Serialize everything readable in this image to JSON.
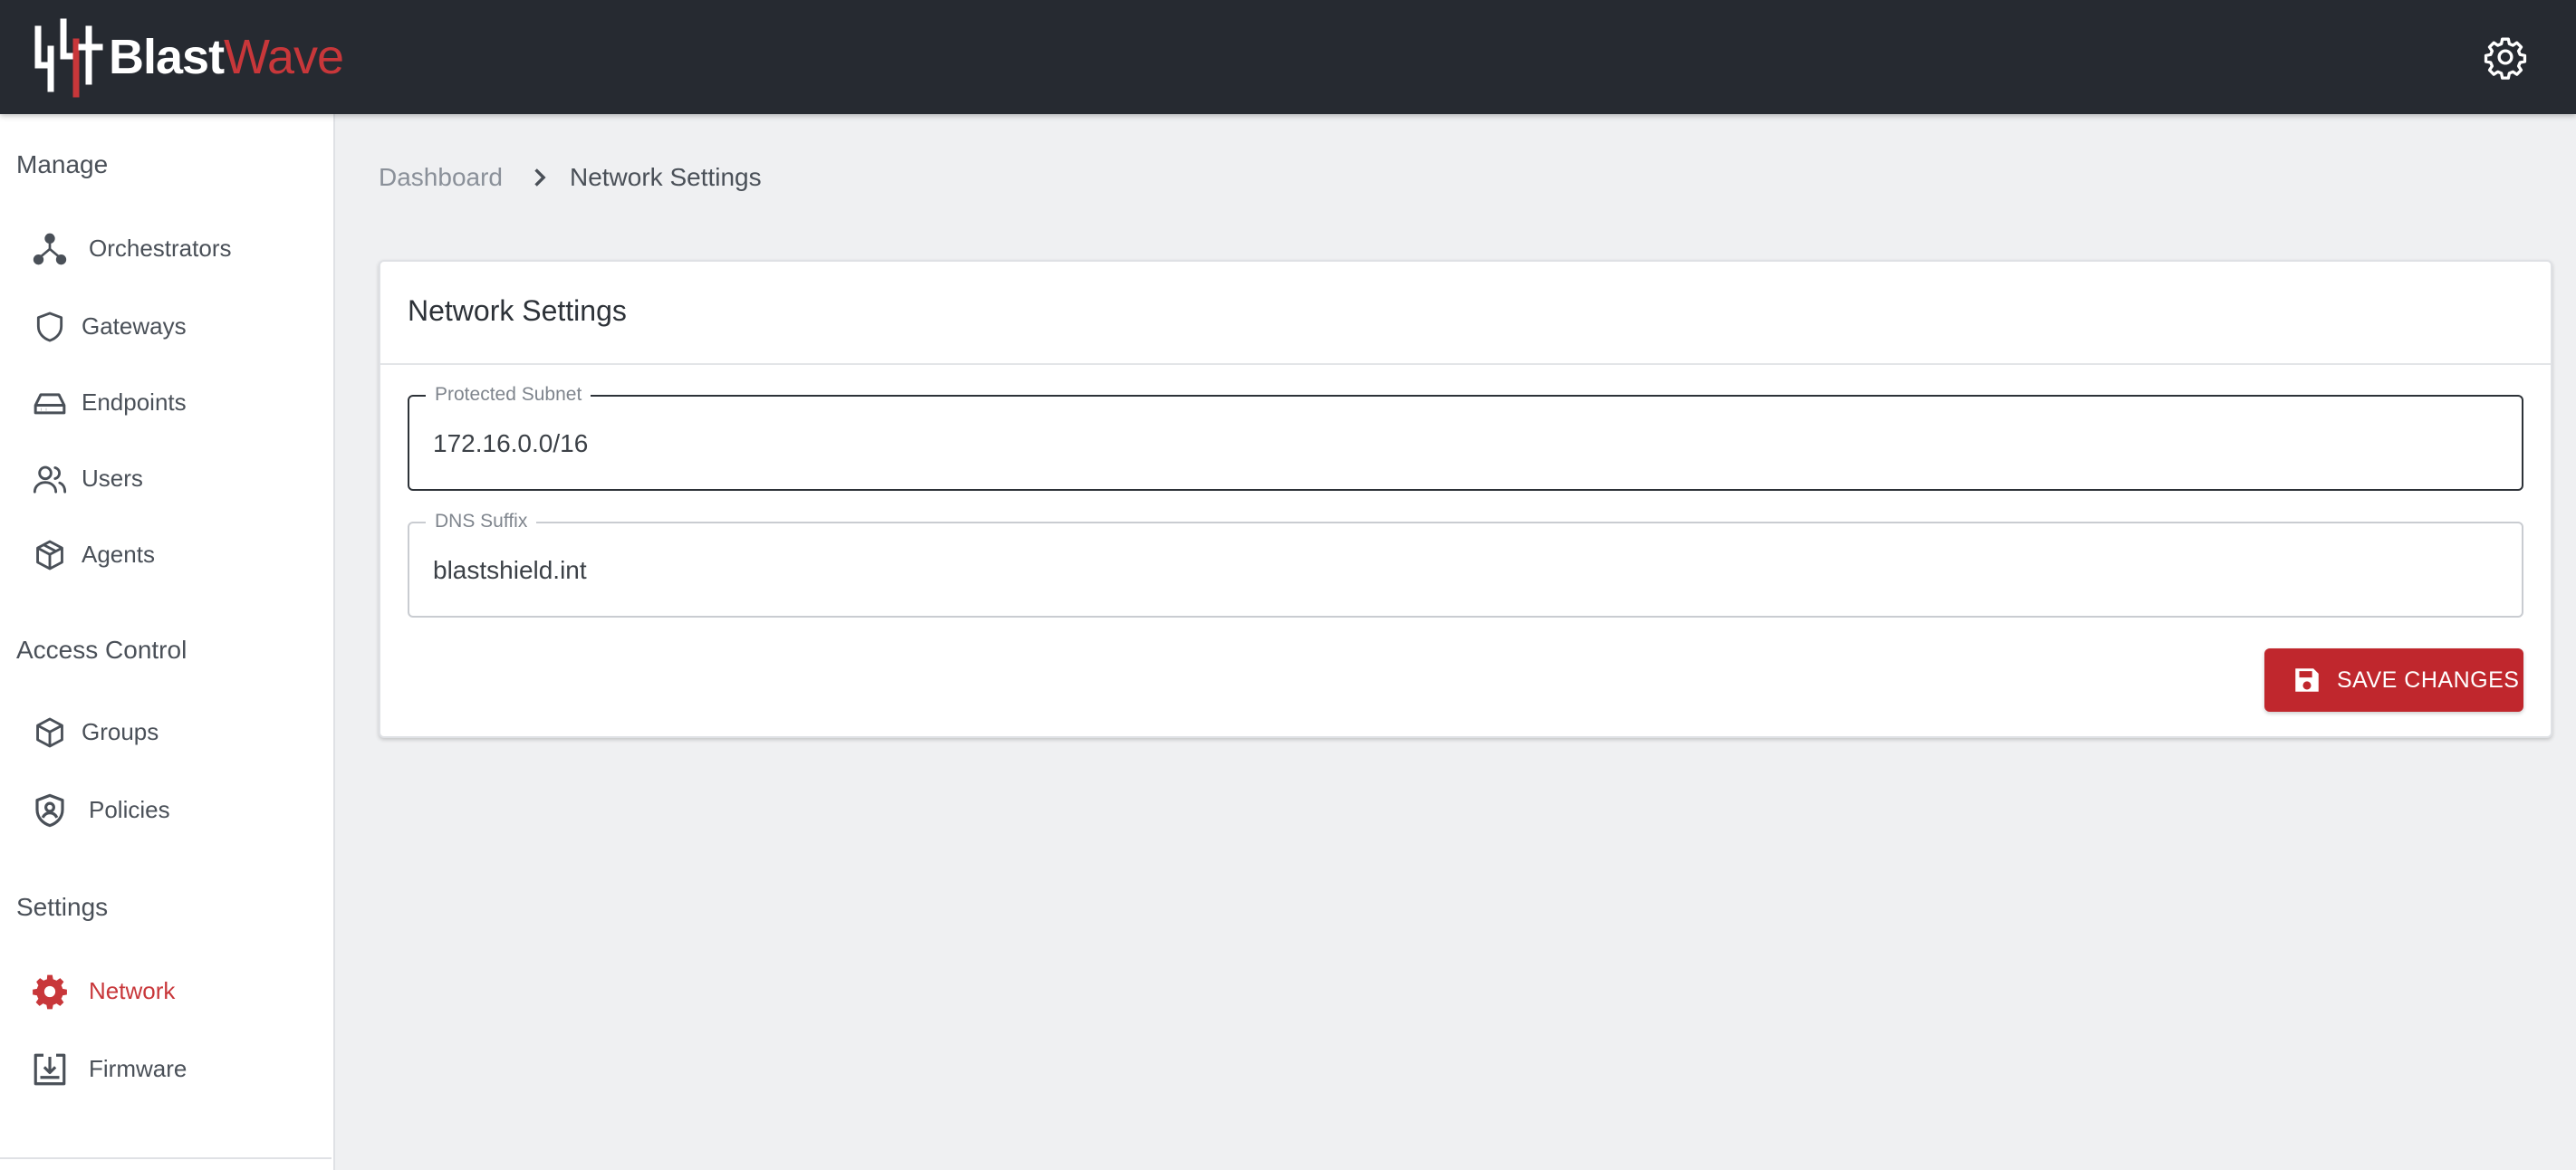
{
  "brand": {
    "name_part1": "Blast",
    "name_part2": "Wave",
    "primary": "#c8373a",
    "topbar_bg": "#262a31"
  },
  "header": {
    "settings_icon": "gear-icon"
  },
  "sidebar": {
    "sections": [
      {
        "title": "Manage",
        "items": [
          {
            "label": "Orchestrators",
            "icon": "network-hub-icon"
          },
          {
            "label": "Gateways",
            "icon": "shield-icon"
          },
          {
            "label": "Endpoints",
            "icon": "hard-drive-icon"
          },
          {
            "label": "Users",
            "icon": "users-icon"
          },
          {
            "label": "Agents",
            "icon": "cube-icon"
          }
        ]
      },
      {
        "title": "Access Control",
        "items": [
          {
            "label": "Groups",
            "icon": "cube-icon"
          },
          {
            "label": "Policies",
            "icon": "shield-user-icon"
          }
        ]
      },
      {
        "title": "Settings",
        "items": [
          {
            "label": "Network",
            "icon": "gear-icon",
            "active": true
          },
          {
            "label": "Firmware",
            "icon": "download-tray-icon"
          }
        ]
      }
    ]
  },
  "breadcrumb": {
    "parent": "Dashboard",
    "current": "Network Settings"
  },
  "card": {
    "title": "Network Settings",
    "fields": [
      {
        "label": "Protected Subnet",
        "value": "172.16.0.0/16",
        "focused": true
      },
      {
        "label": "DNS Suffix",
        "value": "blastshield.int",
        "focused": false
      }
    ],
    "save_label": "SAVE CHANGES",
    "save_icon": "floppy-disk-icon"
  }
}
